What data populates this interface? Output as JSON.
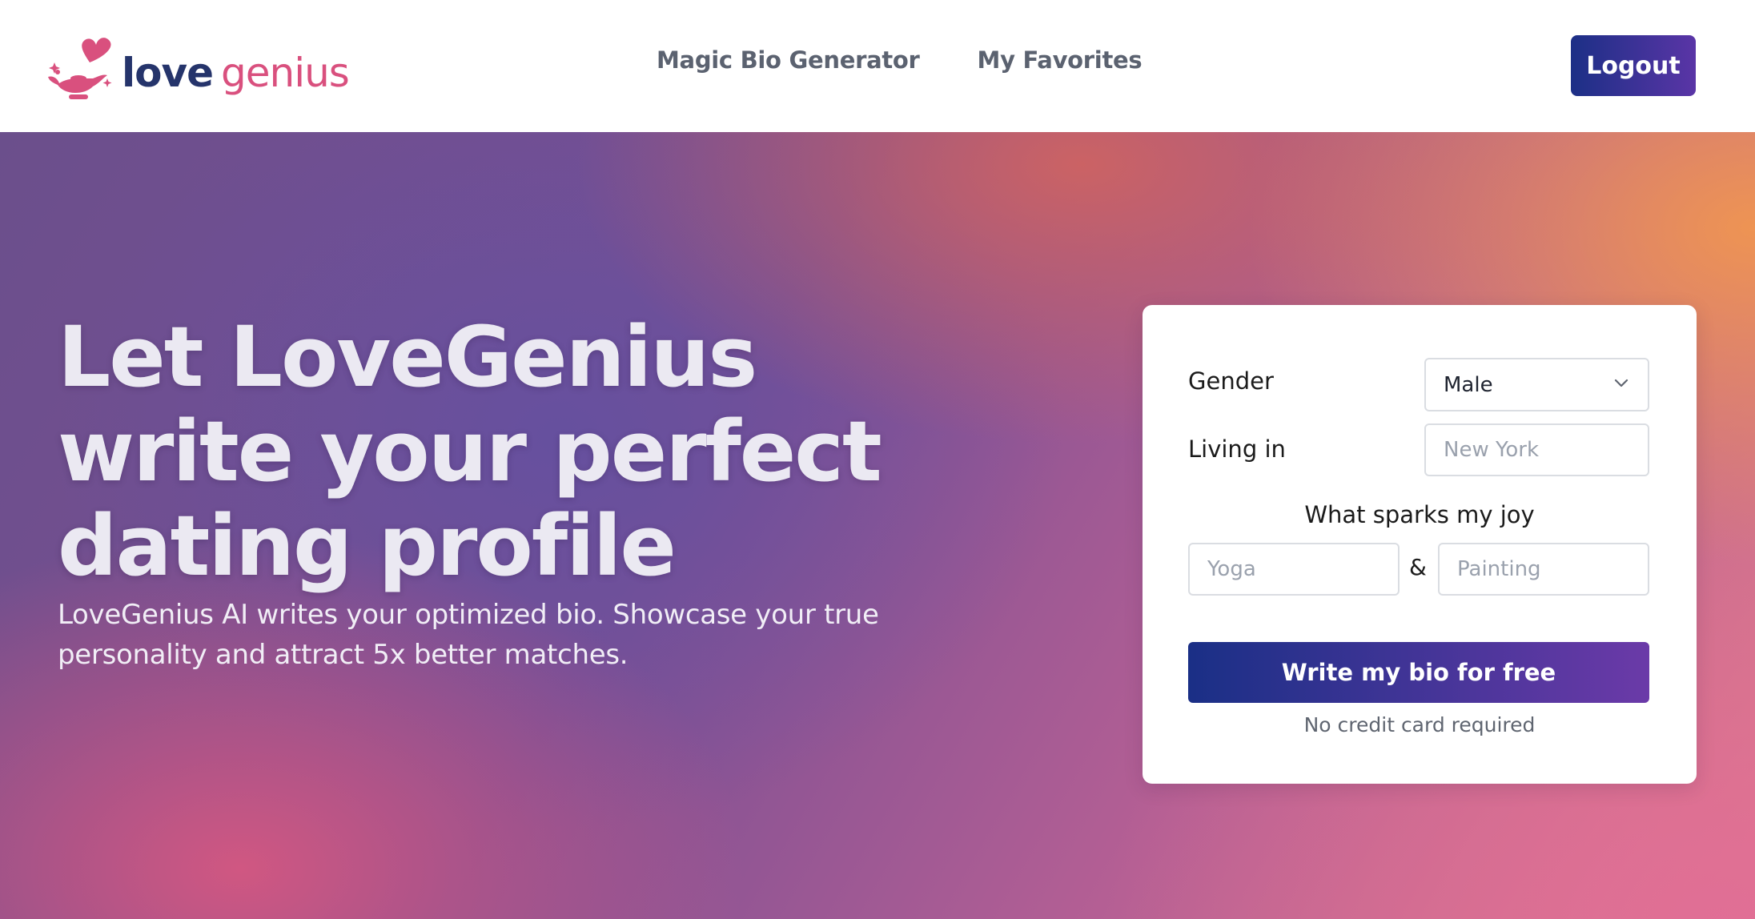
{
  "header": {
    "logo": {
      "love": "love",
      "genius": "genius",
      "icon": "genie-lamp-heart-icon"
    },
    "nav": [
      {
        "label": "Magic Bio Generator"
      },
      {
        "label": "My Favorites"
      }
    ],
    "logout_label": "Logout"
  },
  "hero": {
    "title": "Let LoveGenius write your perfect dating profile",
    "subtitle": "LoveGenius AI writes your optimized bio. Showcase your true personality and attract 5x better matches."
  },
  "form": {
    "gender": {
      "label": "Gender",
      "value": "Male",
      "icon": "chevron-down-icon"
    },
    "living": {
      "label": "Living in",
      "placeholder": "New York"
    },
    "joy": {
      "label": "What sparks my joy",
      "first_placeholder": "Yoga",
      "separator": "&",
      "second_placeholder": "Painting"
    },
    "submit_label": "Write my bio for free",
    "note": "No credit card required"
  },
  "colors": {
    "brand_navy": "#25346b",
    "brand_pink": "#d9507e",
    "button_gradient_start": "#1c2f86",
    "button_gradient_end": "#5a35a6"
  }
}
